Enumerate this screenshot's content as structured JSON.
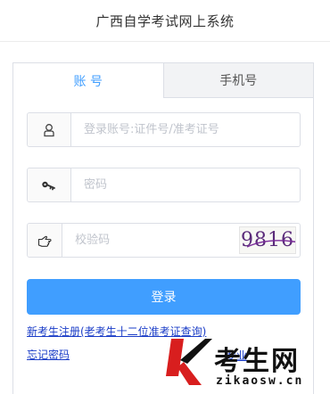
{
  "header": {
    "title": "广西自学考试网上系统"
  },
  "tabs": [
    {
      "label": "账 号",
      "active": true
    },
    {
      "label": "手机号",
      "active": false
    }
  ],
  "form": {
    "username_placeholder": "登录账号:证件号/准考证号",
    "password_placeholder": "密码",
    "captcha_placeholder": "校验码",
    "captcha_text": "9816",
    "login_label": "登录"
  },
  "links": {
    "register": "新考生注册(老考生十二位准考证查询)",
    "forgot_password": "忘记密码",
    "partial_right": "专业"
  },
  "watermark": {
    "brand": "考生网",
    "domain": "zikaosw.cn"
  },
  "colors": {
    "accent": "#409eff",
    "link": "#1a3cc7",
    "watermark_red": "#d81e1e"
  }
}
